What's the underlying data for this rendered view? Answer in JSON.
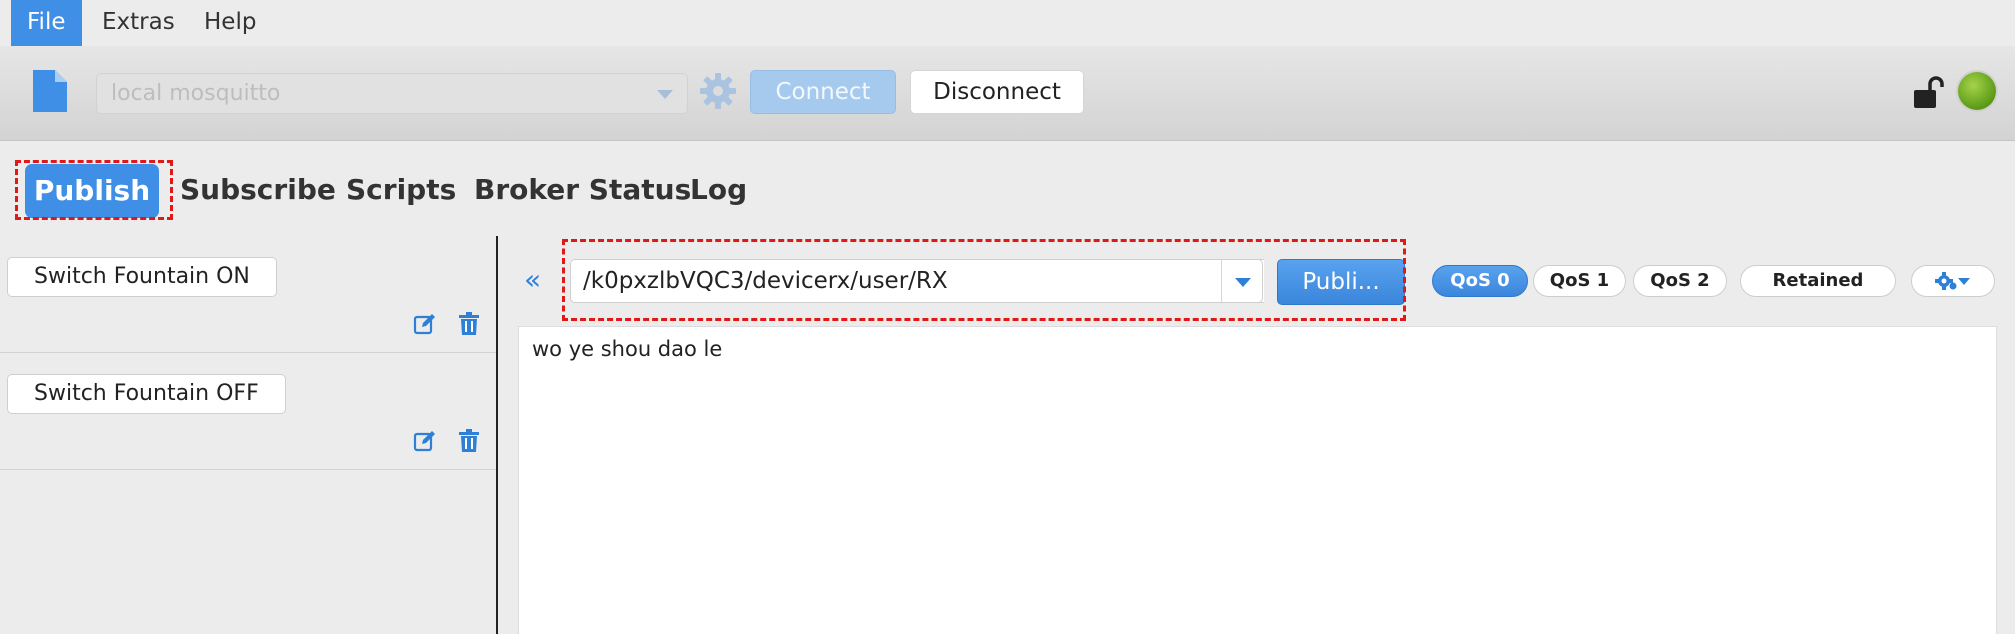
{
  "menubar": {
    "items": [
      "File",
      "Extras",
      "Help"
    ],
    "active": "File"
  },
  "toolbar": {
    "connection_profile": "local mosquitto",
    "connect_label": "Connect",
    "disconnect_label": "Disconnect"
  },
  "tabs": [
    "Publish",
    "Subscribe",
    "Scripts",
    "Broker Status",
    "Log"
  ],
  "active_tab": "Publish",
  "scripts": [
    {
      "label": "Switch Fountain ON"
    },
    {
      "label": "Switch Fountain OFF"
    }
  ],
  "publish": {
    "topic": "/k0pxzlbVQC3/devicerx/user/RX",
    "publish_label": "Publi...",
    "qos": [
      "QoS 0",
      "QoS 1",
      "QoS 2"
    ],
    "active_qos": "QoS 0",
    "retained_label": "Retained",
    "payload": "wo ye shou dao le"
  },
  "colors": {
    "accent": "#3f8fe6",
    "highlight": "#e01818",
    "status_connected": "#6aa81f"
  },
  "icons": [
    "file-icon",
    "gear-icon",
    "lock-open-icon",
    "edit-icon",
    "trash-icon",
    "double-chevron-left-icon",
    "settings-gear-icon"
  ]
}
